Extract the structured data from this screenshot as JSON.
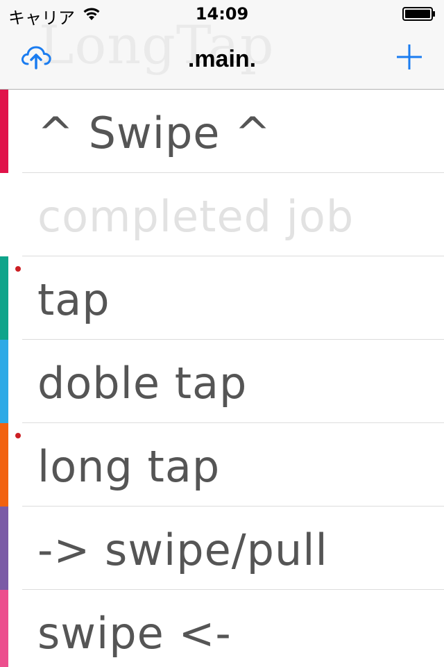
{
  "status_bar": {
    "carrier": "キャリア",
    "time": "14:09"
  },
  "nav": {
    "title": ".main.",
    "ghost_title": "LongTap",
    "left_icon": "cloud-upload-icon",
    "right_icon": "plus-icon",
    "accent_color": "#1a7cf0"
  },
  "tasks": [
    {
      "label": "^ Swipe ^",
      "color": "#e0134a",
      "completed": false,
      "flagged": false
    },
    {
      "label": "completed job",
      "color": "",
      "completed": true,
      "flagged": false
    },
    {
      "label": "tap",
      "color": "#0fa48a",
      "completed": false,
      "flagged": true
    },
    {
      "label": "doble tap",
      "color": "#2eaae6",
      "completed": false,
      "flagged": false
    },
    {
      "label": "long tap",
      "color": "#f2620f",
      "completed": false,
      "flagged": true
    },
    {
      "label": "-> swipe/pull",
      "color": "#7b5ba6",
      "completed": false,
      "flagged": false
    },
    {
      "label": "swipe <-",
      "color": "#ec4f8e",
      "completed": false,
      "flagged": false
    }
  ]
}
